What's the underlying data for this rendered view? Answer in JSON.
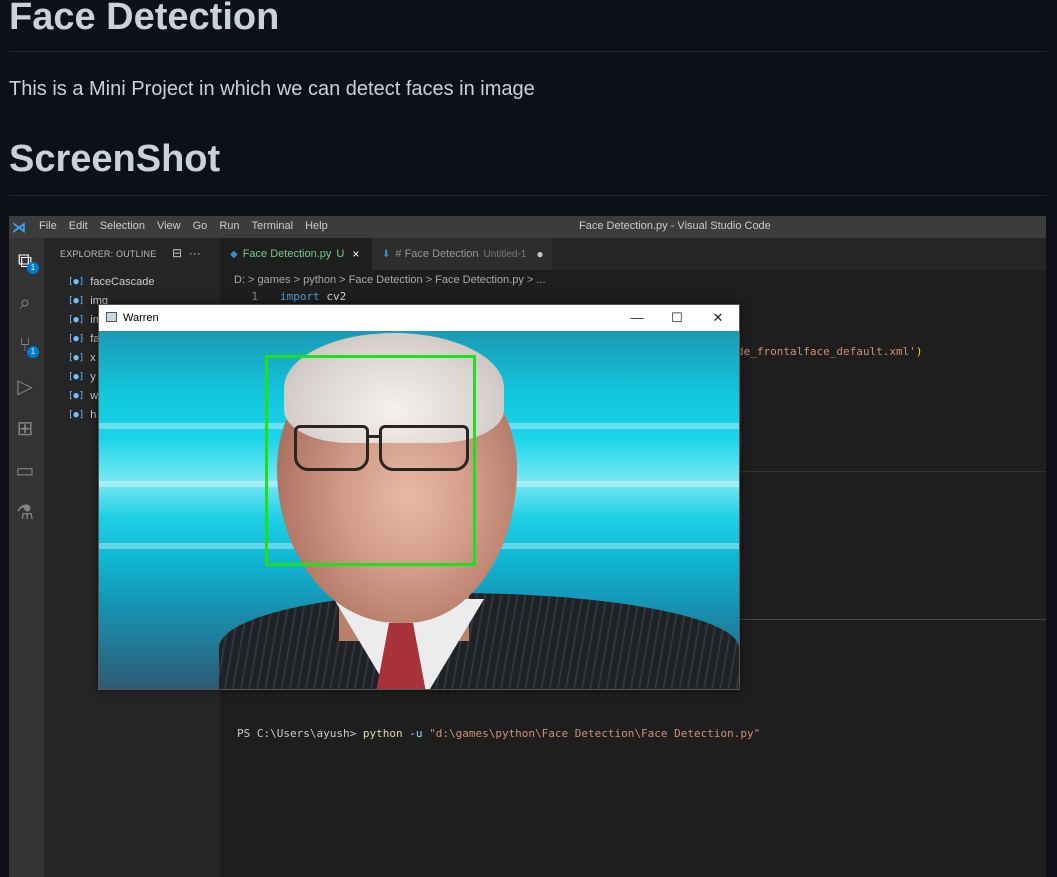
{
  "readme": {
    "title": "Face Detection",
    "description": "This is a Mini Project in which we can detect faces in image",
    "screenshot_heading": "ScreenShot"
  },
  "vscode": {
    "menu": [
      "File",
      "Edit",
      "Selection",
      "View",
      "Go",
      "Run",
      "Terminal",
      "Help"
    ],
    "window_title": "Face Detection.py - Visual Studio Code",
    "activity_badges": {
      "explorer": "1",
      "source_control": "1"
    },
    "sidebar": {
      "title": "EXPLORER: OUTLINE",
      "outline_items": [
        "faceCascade",
        "img",
        "im",
        "fac",
        "x",
        "y",
        "w",
        "h"
      ]
    },
    "tabs": [
      {
        "label": "Face Detection.py",
        "status": "U",
        "close": "×"
      },
      {
        "label": "# Face Detection",
        "sub": "Untitled-1",
        "dot": "●"
      }
    ],
    "breadcrumb": "D: > games > python > Face Detection > Face Detection.py > ...",
    "code": {
      "line_number": "1",
      "keyword": "import",
      "module": "cv2",
      "partial_string": "de_frontalface_default.xml'",
      "partial_close": ")"
    },
    "terminal": {
      "prompt": "PS C:\\Users\\ayush>",
      "command": "python",
      "flag": "-u",
      "arg": "\"d:\\games\\python\\Face Detection\\Face Detection.py\""
    }
  },
  "image_window": {
    "title": "Warren",
    "buttons": {
      "minimize": "—",
      "maximize": "☐",
      "close": "✕"
    },
    "detection_box_color": "#22dd22"
  }
}
